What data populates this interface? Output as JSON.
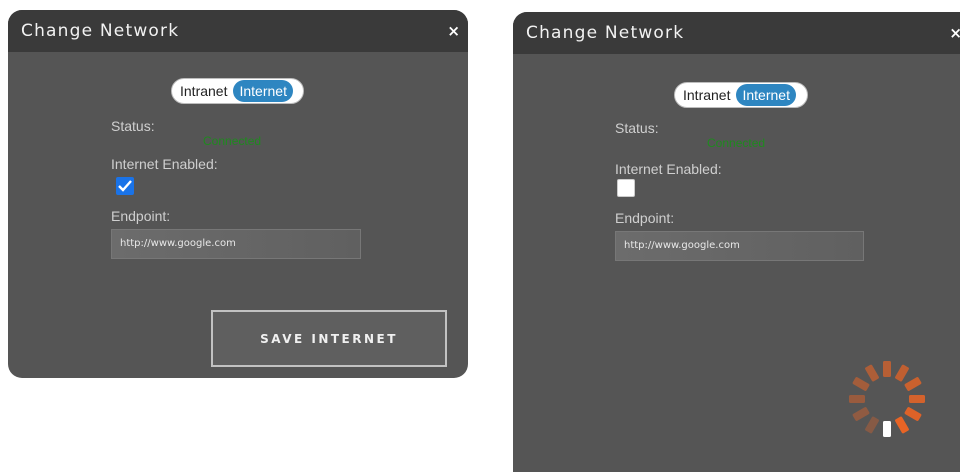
{
  "dialogs": [
    {
      "title": "Change Network",
      "close_label": "×",
      "toggle": {
        "options": [
          "Intranet",
          "Internet"
        ],
        "selected": "Internet"
      },
      "status_label": "Status:",
      "status_value": "Connected",
      "internet_enabled_label": "Internet Enabled:",
      "internet_enabled": true,
      "endpoint_label": "Endpoint:",
      "endpoint_value": "http://www.google.com",
      "save_label": "SAVE INTERNET"
    },
    {
      "title": "Change Network",
      "close_label": "×",
      "toggle": {
        "options": [
          "Intranet",
          "Internet"
        ],
        "selected": "Internet"
      },
      "status_label": "Status:",
      "status_value": "Connected",
      "internet_enabled_label": "Internet Enabled:",
      "internet_enabled": false,
      "endpoint_label": "Endpoint:",
      "endpoint_value": "http://www.google.com",
      "loading_icon": "spinner-icon"
    }
  ],
  "colors": {
    "accent": "#2e86c1",
    "status_connected": "#1e8a1e",
    "checkbox_checked": "#1a73e8",
    "spinner": "#f26522"
  }
}
